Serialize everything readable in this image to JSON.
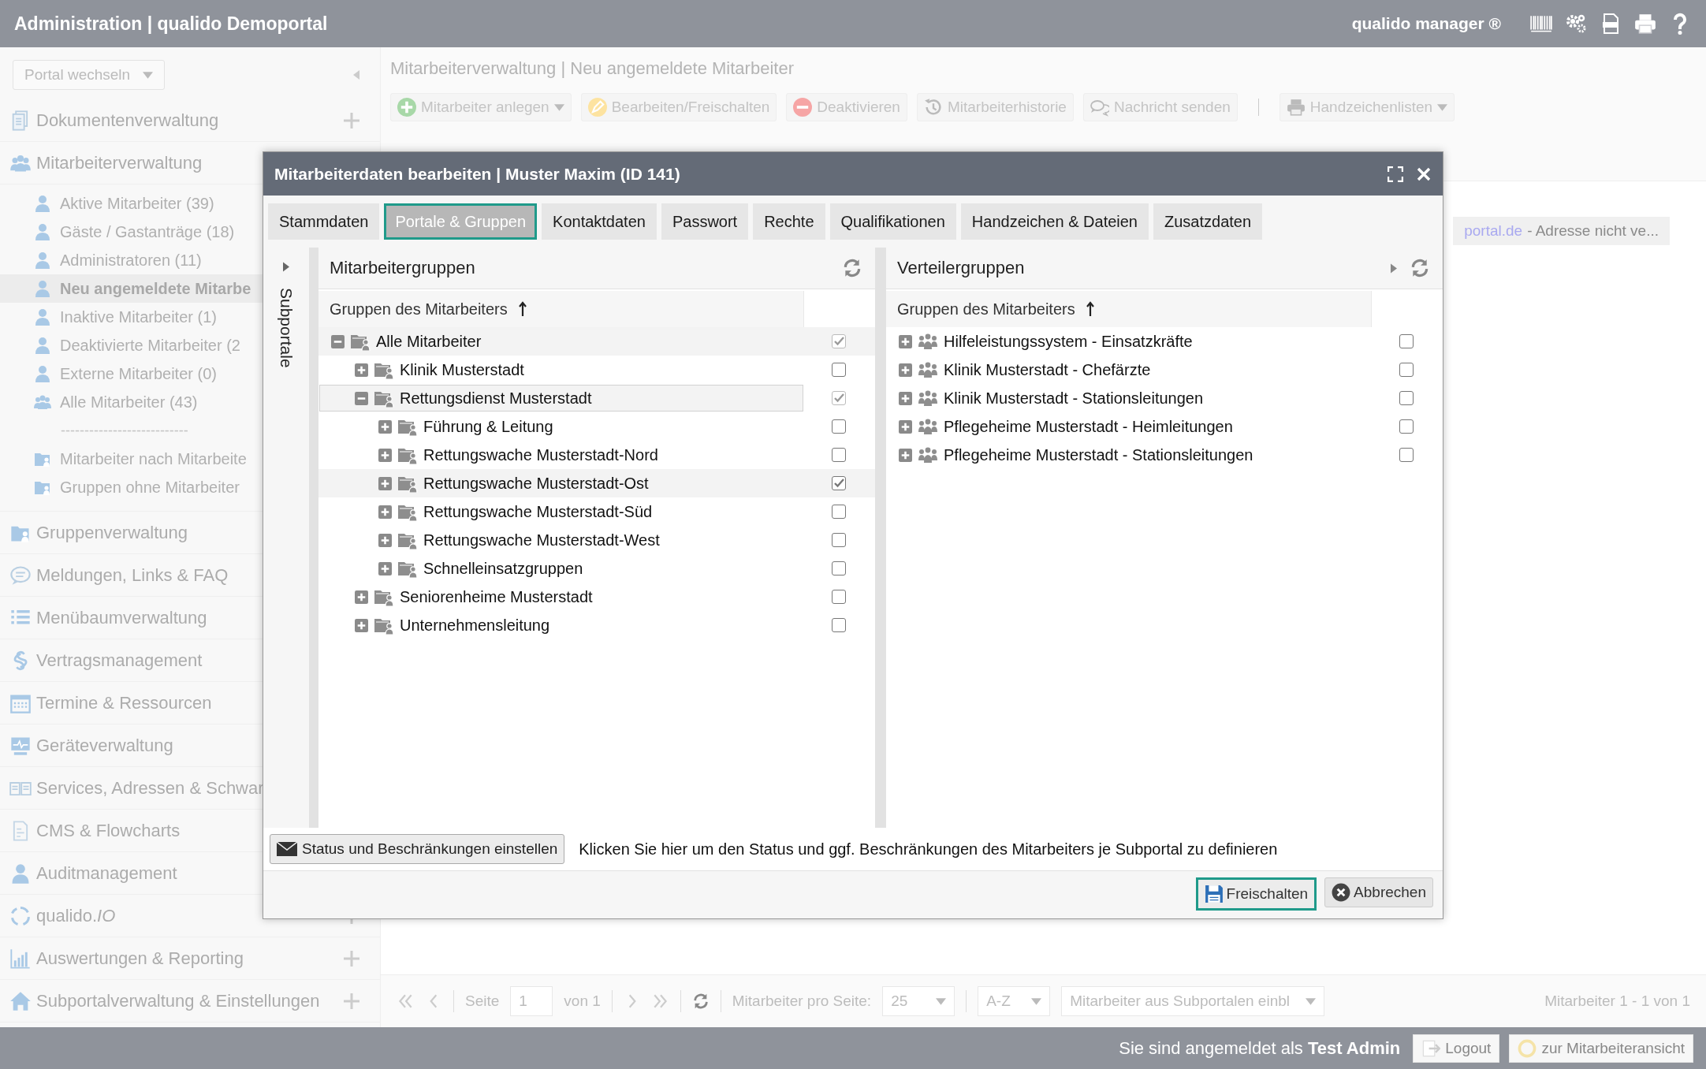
{
  "header": {
    "title": "Administration | qualido Demoportal",
    "product": "qualido manager ®"
  },
  "sidebar": {
    "portal_select": "Portal wechseln",
    "sections": [
      {
        "label": "Dokumentenverwaltung",
        "plus": true
      },
      {
        "label": "Mitarbeiterverwaltung",
        "items": [
          {
            "kind": "entry",
            "label": "Aktive Mitarbeiter (39)",
            "selected": false
          },
          {
            "kind": "entry",
            "label": "Gäste / Gastanträge (18)",
            "selected": false
          },
          {
            "kind": "entry",
            "label": "Administratoren (11)",
            "selected": false
          },
          {
            "kind": "entry",
            "label": "Neu angemeldete Mitarbe",
            "selected": true
          },
          {
            "kind": "entry",
            "label": "Inaktive Mitarbeiter (1)",
            "selected": false
          },
          {
            "kind": "entry",
            "label": "Deaktivierte Mitarbeiter (2",
            "selected": false
          },
          {
            "kind": "entry",
            "label": "Externe Mitarbeiter (0)",
            "selected": false
          },
          {
            "kind": "entry",
            "label": "Alle Mitarbeiter (43)",
            "selected": false
          },
          {
            "kind": "separator",
            "label": "---------------------------"
          },
          {
            "kind": "entry",
            "label": "Mitarbeiter nach Mitarbeite",
            "selected": false
          },
          {
            "kind": "entry",
            "label": "Gruppen ohne Mitarbeiter",
            "selected": false
          }
        ]
      },
      {
        "label": "Gruppenverwaltung"
      },
      {
        "label": "Meldungen, Links & FAQ"
      },
      {
        "label": "Menübaumverwaltung"
      },
      {
        "label": "Vertragsmanagement"
      },
      {
        "label": "Termine & Ressourcen"
      },
      {
        "label": "Geräteverwaltung"
      },
      {
        "label": "Services, Adressen & Schwar"
      },
      {
        "label": "CMS & Flowcharts"
      },
      {
        "label": "Auditmanagement"
      },
      {
        "label": "qualido.*IO*",
        "plus": true
      },
      {
        "label": "Auswertungen & Reporting",
        "plus": true
      },
      {
        "label": "Subportalverwaltung & Einstellungen",
        "plus": true
      }
    ]
  },
  "main": {
    "breadcrumb": "Mitarbeiterverwaltung | Neu angemeldete Mitarbeiter",
    "toolbar": [
      {
        "label": "Mitarbeiter anlegen",
        "dropdown": true
      },
      {
        "label": "Bearbeiten/Freischalten",
        "dropdown": false
      },
      {
        "label": "Deaktivieren",
        "dropdown": false
      },
      {
        "label": "Mitarbeiterhistorie",
        "dropdown": false
      },
      {
        "label": "Nachricht senden",
        "dropdown": false
      },
      {
        "label": "Handzeichenlisten",
        "dropdown": true
      }
    ],
    "note": {
      "link": "portal.de",
      "text": "- Adresse nicht ve..."
    },
    "pagination": {
      "page_label": "Seite",
      "page": "1",
      "of": "von 1",
      "per_page_label": "Mitarbeiter pro Seite:",
      "per_page": "25",
      "sort": "A-Z",
      "subportal_select": "Mitarbeiter aus Subportalen einbl",
      "summary": "Mitarbeiter 1 - 1 von 1"
    }
  },
  "footer": {
    "login_text": "Sie sind angemeldet als **Test Admin**",
    "buttons": [
      "Logout",
      "zur Mitarbeiteransicht"
    ]
  },
  "dialog": {
    "title": "Mitarbeiterdaten bearbeiten | Muster Maxim (ID 141)",
    "tabs": [
      {
        "label": "Stammdaten",
        "selected": false
      },
      {
        "label": "Portale & Gruppen",
        "selected": true
      },
      {
        "label": "Kontaktdaten",
        "selected": false
      },
      {
        "label": "Passwort",
        "selected": false
      },
      {
        "label": "Rechte",
        "selected": false
      },
      {
        "label": "Qualifikationen",
        "selected": false
      },
      {
        "label": "Handzeichen & Dateien",
        "selected": false
      },
      {
        "label": "Zusatzdaten",
        "selected": false
      }
    ],
    "side_strip": "Subportale",
    "left_panel": {
      "title": "Mitarbeitergruppen",
      "column": "Gruppen des Mitarbeiters",
      "tree": [
        {
          "label": "Alle Mitarbeiter",
          "expanded": true,
          "checked": true,
          "disabled": true,
          "selected": false,
          "highlighted": true,
          "children": [
            {
              "label": "Klinik Musterstadt",
              "expanded": false,
              "checked": false,
              "disabled": false,
              "selected": false,
              "highlighted": false
            },
            {
              "label": "Rettungsdienst Musterstadt",
              "expanded": true,
              "checked": true,
              "disabled": true,
              "selected": true,
              "highlighted": false,
              "children": [
                {
                  "label": "Führung & Leitung",
                  "expanded": false,
                  "checked": false,
                  "disabled": false,
                  "selected": false,
                  "highlighted": false
                },
                {
                  "label": "Rettungswache Musterstadt-Nord",
                  "expanded": false,
                  "checked": false,
                  "disabled": false,
                  "selected": false,
                  "highlighted": false
                },
                {
                  "label": "Rettungswache Musterstadt-Ost",
                  "expanded": false,
                  "checked": true,
                  "disabled": false,
                  "selected": false,
                  "highlighted": true
                },
                {
                  "label": "Rettungswache Musterstadt-Süd",
                  "expanded": false,
                  "checked": false,
                  "disabled": false,
                  "selected": false,
                  "highlighted": false
                },
                {
                  "label": "Rettungswache Musterstadt-West",
                  "expanded": false,
                  "checked": false,
                  "disabled": false,
                  "selected": false,
                  "highlighted": false
                },
                {
                  "label": "Schnelleinsatzgruppen",
                  "expanded": false,
                  "checked": false,
                  "disabled": false,
                  "selected": false,
                  "highlighted": false
                }
              ]
            },
            {
              "label": "Seniorenheime Musterstadt",
              "expanded": false,
              "checked": false,
              "disabled": false,
              "selected": false,
              "highlighted": false
            },
            {
              "label": "Unternehmensleitung",
              "expanded": false,
              "checked": false,
              "disabled": false,
              "selected": false,
              "highlighted": false
            }
          ]
        }
      ]
    },
    "right_panel": {
      "title": "Verteilergruppen",
      "column": "Gruppen des Mitarbeiters",
      "tree": [
        {
          "label": "Hilfeleistungssystem - Einsatzkräfte",
          "expanded": false,
          "checked": false,
          "disabled": false,
          "selected": false,
          "highlighted": false
        },
        {
          "label": "Klinik Musterstadt - Chefärzte",
          "expanded": false,
          "checked": false,
          "disabled": false,
          "selected": false,
          "highlighted": false
        },
        {
          "label": "Klinik Musterstadt - Stationsleitungen",
          "expanded": false,
          "checked": false,
          "disabled": false,
          "selected": false,
          "highlighted": false
        },
        {
          "label": "Pflegeheime Musterstadt - Heimleitungen",
          "expanded": false,
          "checked": false,
          "disabled": false,
          "selected": false,
          "highlighted": false
        },
        {
          "label": "Pflegeheime Musterstadt - Stationsleitungen",
          "expanded": false,
          "checked": false,
          "disabled": false,
          "selected": false,
          "highlighted": false
        }
      ]
    },
    "status_button": "Status und Beschränkungen einstellen",
    "hint": "Klicken Sie hier um den Status und ggf. Beschränkungen des Mitarbeiters je Subportal zu definieren",
    "buttons": [
      {
        "label": "Freischalten",
        "kind": "primary"
      },
      {
        "label": "Abbrechen",
        "kind": "cancel"
      }
    ]
  }
}
